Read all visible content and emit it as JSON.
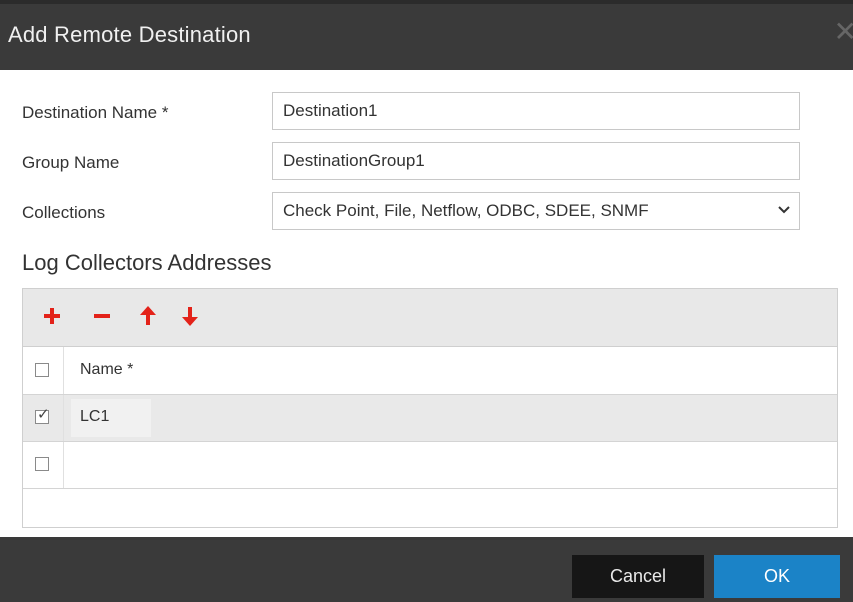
{
  "dialog": {
    "title": "Add Remote Destination"
  },
  "form": {
    "destination_name": {
      "label": "Destination Name *",
      "value": "Destination1"
    },
    "group_name": {
      "label": "Group Name",
      "value": "DestinationGroup1"
    },
    "collections": {
      "label": "Collections",
      "value": "Check Point, File, Netflow, ODBC, SDEE, SNMF"
    }
  },
  "log_collectors": {
    "title": "Log Collectors Addresses",
    "toolbar": {
      "icons": [
        "plus-icon",
        "minus-icon",
        "arrow-up-icon",
        "arrow-down-icon"
      ],
      "icon_color": "#e32219"
    },
    "columns": [
      "Name *"
    ],
    "rows": [
      {
        "checked": true,
        "name": "LC1"
      },
      {
        "checked": false,
        "name": ""
      }
    ]
  },
  "footer": {
    "cancel_label": "Cancel",
    "ok_label": "OK",
    "ok_color": "#1b83c7"
  }
}
